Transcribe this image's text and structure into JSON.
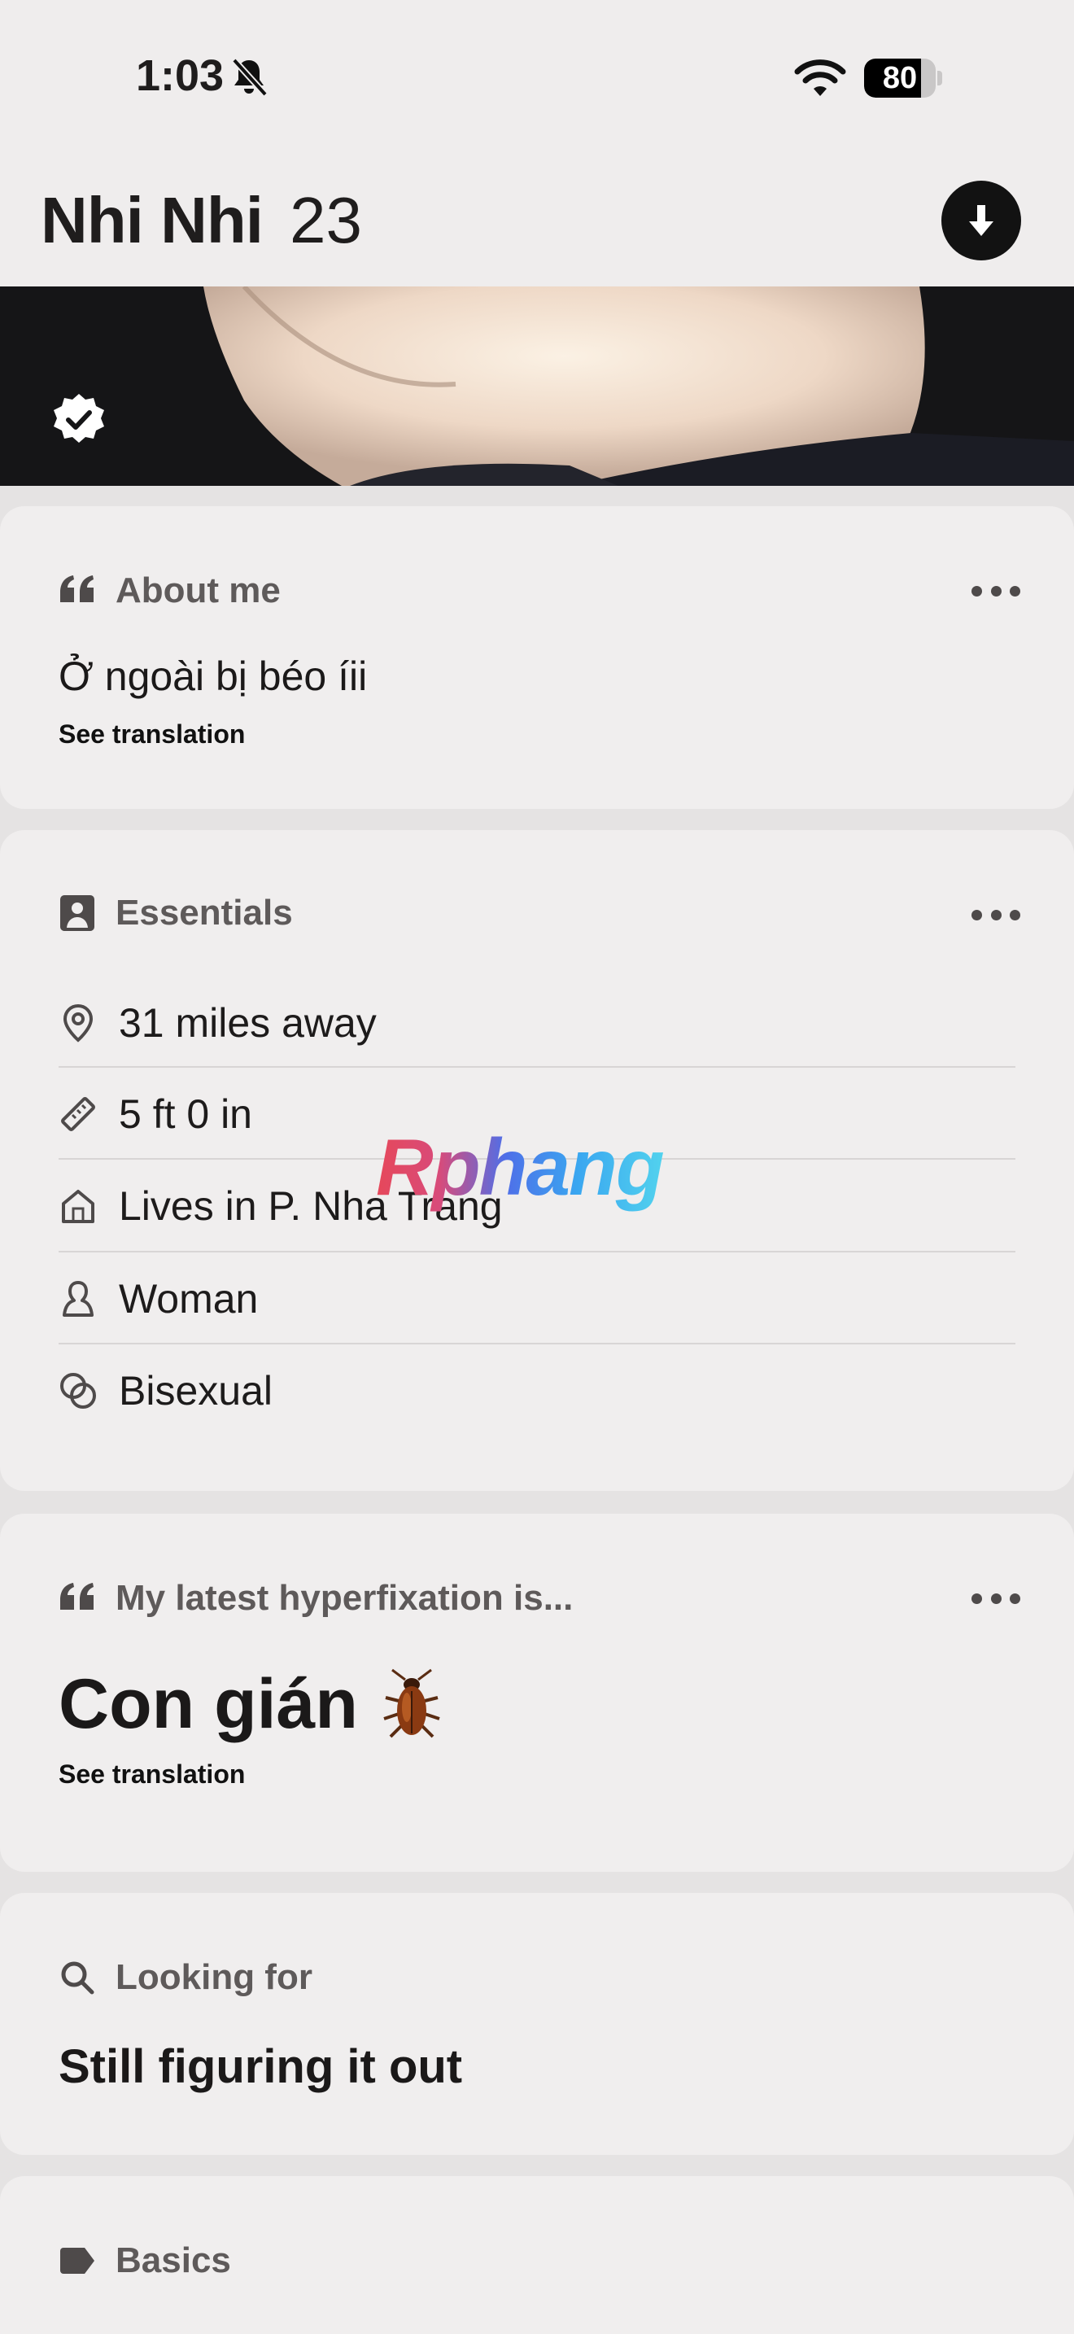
{
  "status_bar": {
    "time": "1:03",
    "battery": "80",
    "battery_level": 0.8
  },
  "header": {
    "name": "Nhi Nhi",
    "age": "23"
  },
  "about": {
    "title": "About me",
    "text": "Ở ngoài bị béo íii",
    "translate": "See translation"
  },
  "essentials": {
    "title": "Essentials",
    "items": [
      {
        "icon": "location-pin-icon",
        "text": "31 miles away"
      },
      {
        "icon": "ruler-icon",
        "text": "5 ft 0 in"
      },
      {
        "icon": "home-icon",
        "text": "Lives in P. Nha Trang"
      },
      {
        "icon": "person-icon",
        "text": "Woman"
      },
      {
        "icon": "orientation-icon",
        "text": "Bisexual"
      }
    ]
  },
  "prompt": {
    "title": "My latest hyperfixation is...",
    "answer": "Con gián",
    "translate": "See translation"
  },
  "looking_for": {
    "title": "Looking for",
    "answer": "Still figuring it out"
  },
  "basics": {
    "title": "Basics"
  },
  "watermark": "Rphang"
}
